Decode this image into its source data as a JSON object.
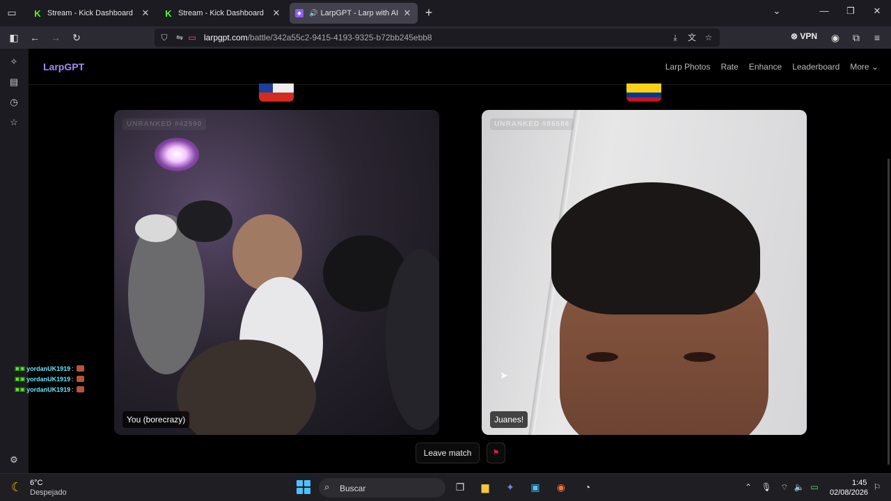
{
  "tabs": [
    {
      "title": "Stream - Kick Dashboard",
      "favicon": "kick-icon"
    },
    {
      "title": "Stream - Kick Dashboard",
      "favicon": "kick-icon"
    },
    {
      "title": "LarpGPT - Larp with AI",
      "favicon": "larpgpt-icon",
      "active": true,
      "playing_audio": true
    }
  ],
  "address": {
    "domain": "larpgpt.com",
    "path": "/battle/342a55c2-9415-4193-9325-b72bb245ebb8"
  },
  "toolbar": {
    "vpn_label": "VPN"
  },
  "site": {
    "logo": "LarpGPT",
    "nav": [
      "Larp Photos",
      "Rate",
      "Enhance",
      "Leaderboard",
      "More"
    ]
  },
  "battle": {
    "left": {
      "rank": "UNRANKED #42590",
      "name": "You (borecrazy)",
      "flag": "chile"
    },
    "right": {
      "rank": "UNRANKED #86586",
      "name": "Juanes!",
      "flag": "colombia"
    },
    "leave_label": "Leave match",
    "report_icon": "flag-icon"
  },
  "chat": [
    {
      "user": "yordanUK1919",
      "sep": ":"
    },
    {
      "user": "yordanUK1919",
      "sep": ":"
    },
    {
      "user": "yordanUK1919",
      "sep": ":"
    }
  ],
  "taskbar": {
    "temperature": "6°C",
    "condition": "Despejado",
    "search_placeholder": "Buscar",
    "time": "1:45",
    "date": "02/08/2026"
  },
  "colors": {
    "brand": "#a78bfa",
    "kick": "#53fc18",
    "report": "#e11d48"
  }
}
